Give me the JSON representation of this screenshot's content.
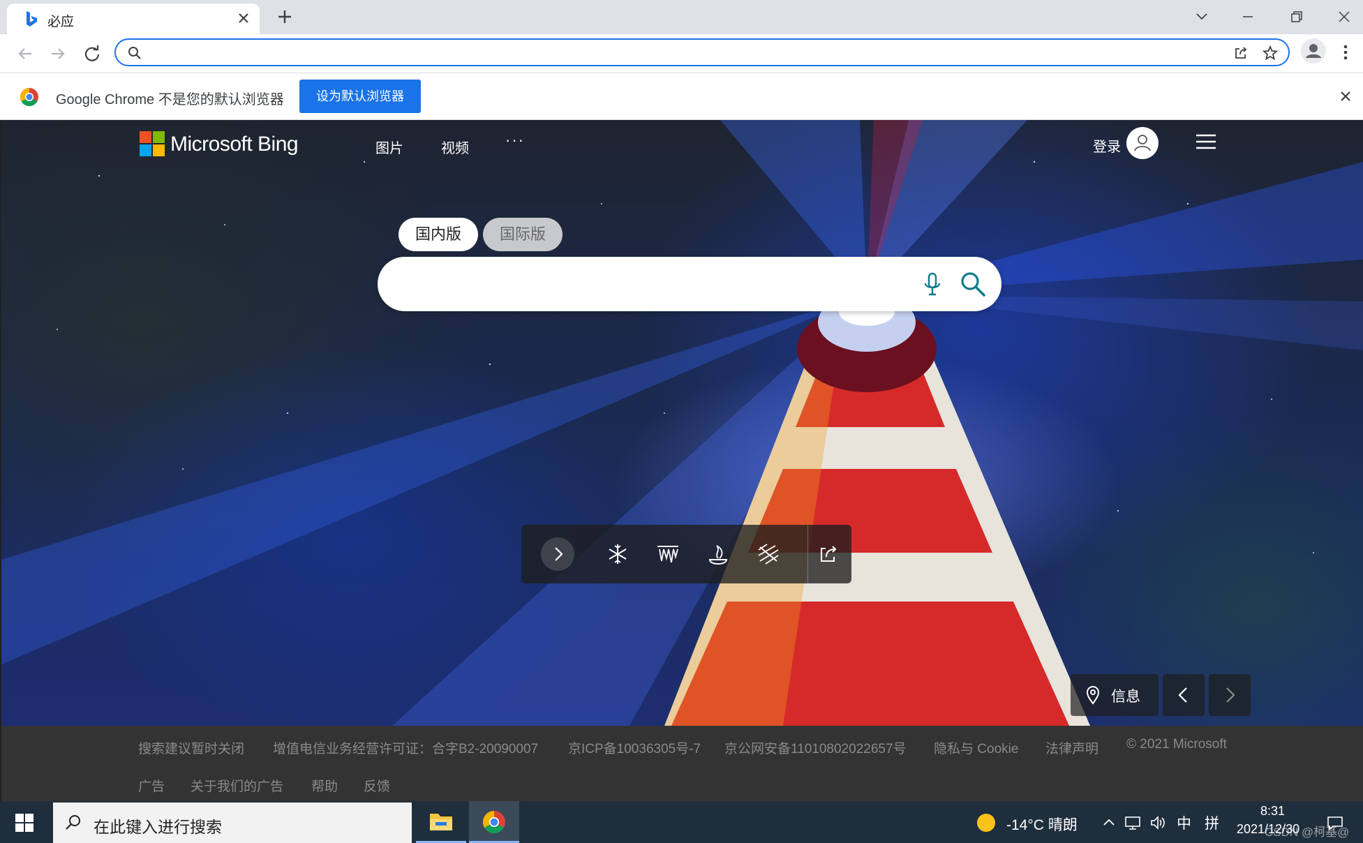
{
  "browser": {
    "tab_title": "必应",
    "address_value": "",
    "infobar_message": "Google Chrome 不是您的默认浏览器",
    "infobar_button": "设为默认浏览器"
  },
  "bing": {
    "logo_text": "Microsoft Bing",
    "nav": [
      "图片",
      "视频"
    ],
    "nav_more": "···",
    "login": "登录",
    "scope_tabs": [
      "国内版",
      "国际版"
    ],
    "search_value": "",
    "info_label": "信息"
  },
  "footer": {
    "row1": [
      "搜索建议暂时关闭",
      "增值电信业务经营许可证：合字B2-20090007",
      "京ICP备10036305号-7",
      "京公网安备11010802022657号",
      "隐私与 Cookie",
      "法律声明",
      "© 2021 Microsoft"
    ],
    "row2": [
      "广告",
      "关于我们的广告",
      "帮助",
      "反馈"
    ]
  },
  "taskbar": {
    "search_placeholder": "在此键入进行搜索",
    "weather": "-14°C  晴朗",
    "ime": "中",
    "ime_mode": "拼",
    "time": "8:31",
    "date": "2021/12/30",
    "watermark": "CSDN @柯基@"
  },
  "colors": {
    "accent": "#1a73e8",
    "bing_teal": "#107c8a"
  }
}
